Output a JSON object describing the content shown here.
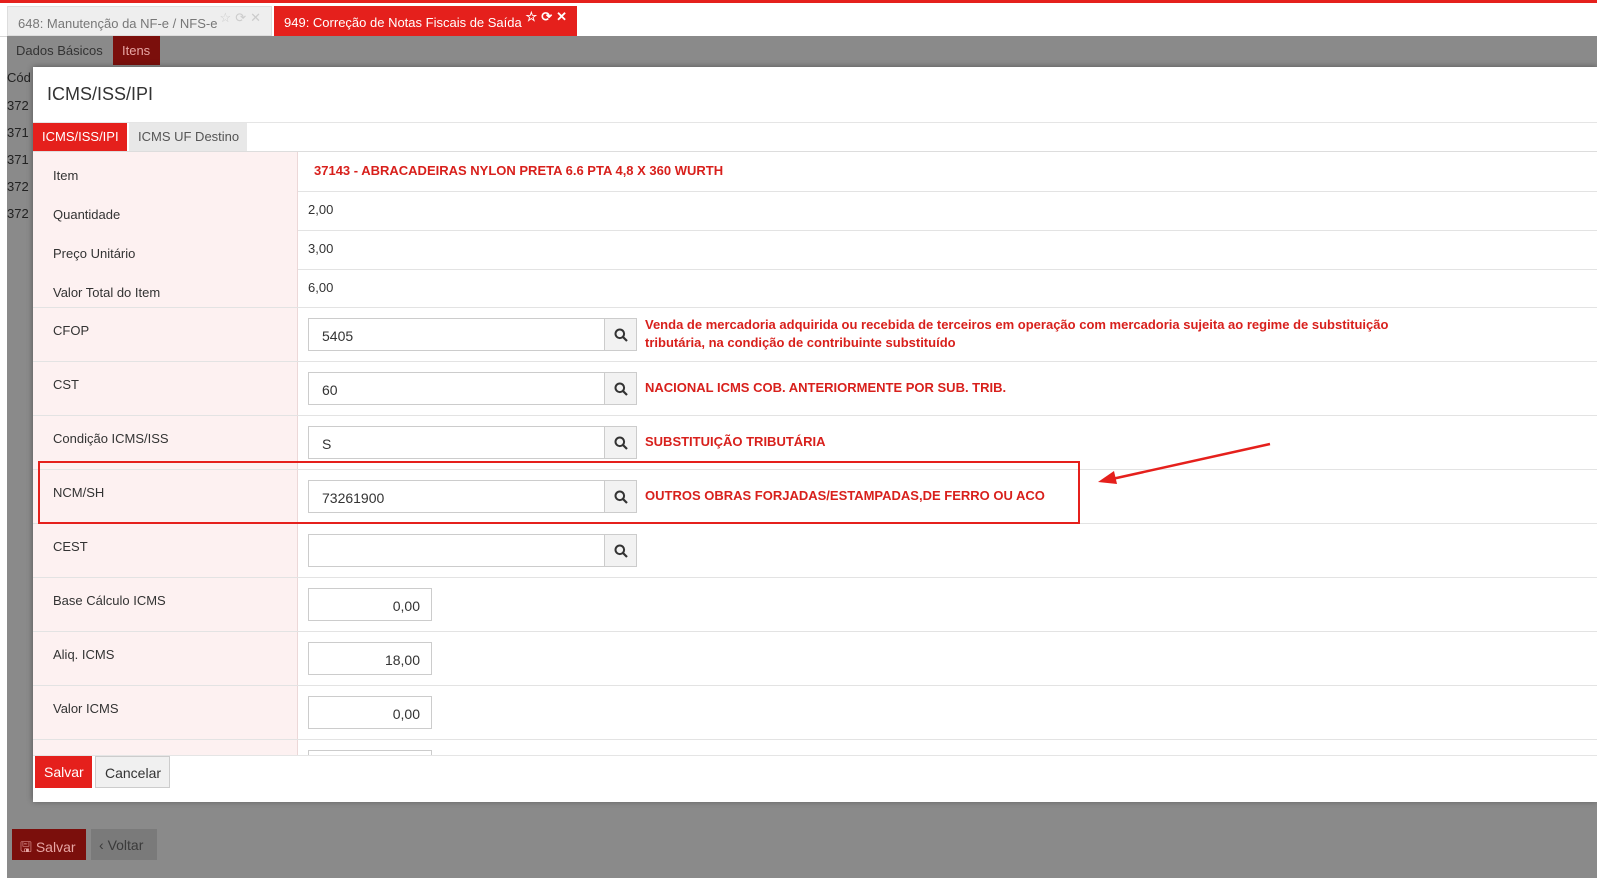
{
  "window_tabs": [
    {
      "label": "648: Manutenção da NF-e / NFS-e",
      "active": false
    },
    {
      "label": "949: Correção de Notas Fiscais de Saída",
      "active": true
    }
  ],
  "tab_icons": [
    "star-icon",
    "refresh-icon",
    "close-icon"
  ],
  "page_tabs": [
    "Dados Básicos",
    "Itens"
  ],
  "background_list": {
    "header": "Cód",
    "rows": [
      "372",
      "371",
      "371",
      "372",
      "372"
    ]
  },
  "modal": {
    "title": "ICMS/ISS/IPI",
    "tabs": [
      "ICMS/ISS/IPI",
      "ICMS UF Destino"
    ],
    "fields": {
      "item": {
        "label": "Item",
        "value": "37143 - ABRACADEIRAS NYLON PRETA 6.6 PTA 4,8 X 360 WURTH"
      },
      "quantidade": {
        "label": "Quantidade",
        "value": "2,00"
      },
      "preco": {
        "label": "Preço Unitário",
        "value": "3,00"
      },
      "valor_total": {
        "label": "Valor Total do Item",
        "value": "6,00"
      },
      "cfop": {
        "label": "CFOP",
        "value": "5405",
        "desc_line1": "Venda de mercadoria adquirida ou recebida de terceiros em operação com mercadoria sujeita ao regime de substituição",
        "desc_line2": "tributária, na condição de contribuinte substituído"
      },
      "cst": {
        "label": "CST",
        "value": "60",
        "desc": "NACIONAL ICMS COB. ANTERIORMENTE POR SUB. TRIB."
      },
      "condicao": {
        "label": "Condição ICMS/ISS",
        "value": "S",
        "desc": "SUBSTITUIÇÃO TRIBUTÁRIA"
      },
      "ncm": {
        "label": "NCM/SH",
        "value": "73261900",
        "desc": "OUTROS OBRAS FORJADAS/ESTAMPADAS,DE FERRO OU ACO"
      },
      "cest": {
        "label": "CEST",
        "value": ""
      },
      "base_calculo": {
        "label": "Base Cálculo ICMS",
        "value": "0,00"
      },
      "aliq": {
        "label": "Aliq. ICMS",
        "value": "18,00"
      },
      "valor_icms": {
        "label": "Valor ICMS",
        "value": "0,00"
      }
    },
    "buttons": {
      "save": "Salvar",
      "cancel": "Cancelar"
    }
  },
  "page_buttons": {
    "save": "Salvar",
    "back": "Voltar"
  },
  "colors": {
    "accent": "#e5201c",
    "label_bg": "#fdf1f1",
    "overlay": "#8a8a8a"
  }
}
